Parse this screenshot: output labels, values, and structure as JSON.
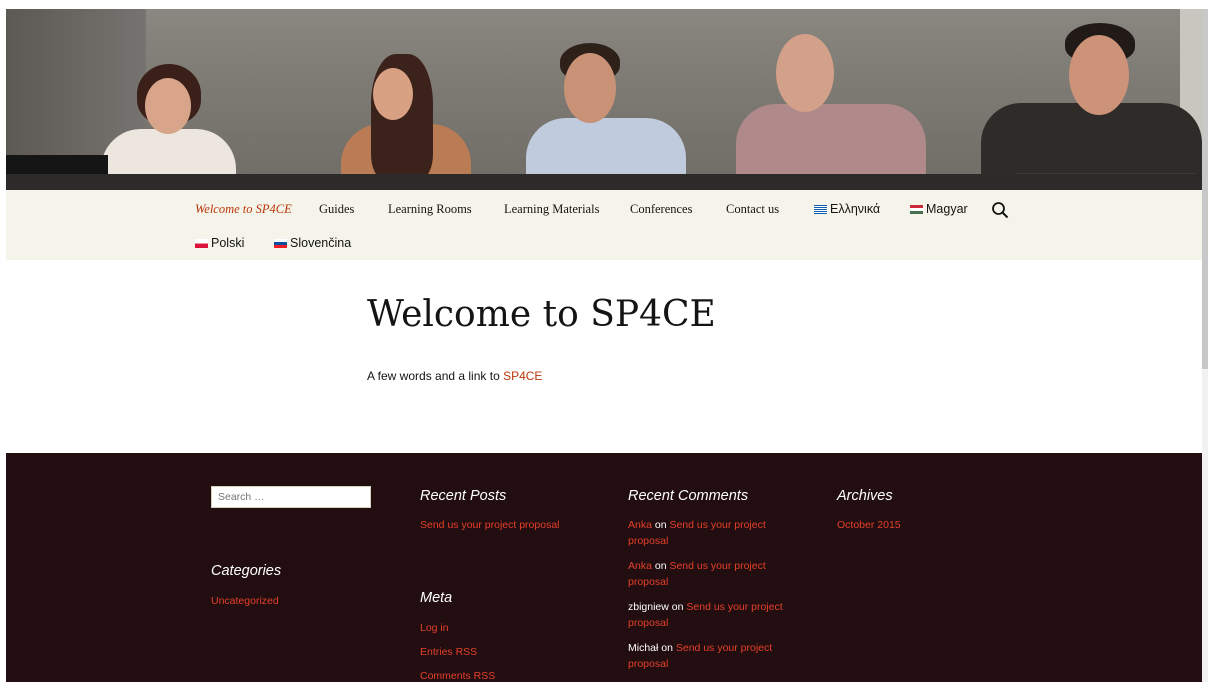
{
  "nav": {
    "items": [
      {
        "label": "Welcome to SP4CE",
        "active": true
      },
      {
        "label": "Guides"
      },
      {
        "label": "Learning Rooms"
      },
      {
        "label": "Learning Materials"
      },
      {
        "label": "Conferences"
      },
      {
        "label": "Contact us"
      },
      {
        "label": "Ελληνικά",
        "flag": "greece-flag-icon"
      },
      {
        "label": "Magyar",
        "flag": "hungary-flag-icon"
      },
      {
        "label": "Polski",
        "flag": "poland-flag-icon"
      },
      {
        "label": "Slovenčina",
        "flag": "slovakia-flag-icon"
      }
    ],
    "search_icon": "search-icon"
  },
  "main": {
    "title": "Welcome to SP4CE",
    "intro_text": "A few words and a link to ",
    "intro_link": "SP4CE"
  },
  "footer": {
    "search_placeholder": "Search …",
    "categories": {
      "title": "Categories",
      "items": [
        "Uncategorized"
      ]
    },
    "recent_posts": {
      "title": "Recent Posts",
      "items": [
        "Send us your project proposal"
      ]
    },
    "meta": {
      "title": "Meta",
      "items": [
        "Log in",
        "Entries RSS",
        "Comments RSS"
      ]
    },
    "recent_comments": {
      "title": "Recent Comments",
      "items": [
        {
          "author": "Anka",
          "author_linked": true,
          "on": "on",
          "post": "Send us your project proposal"
        },
        {
          "author": "Anka",
          "author_linked": true,
          "on": "on",
          "post": "Send us your project proposal"
        },
        {
          "author": "zbigniew",
          "author_linked": false,
          "on": "on",
          "post": "Send us your project proposal"
        },
        {
          "author": "Michał",
          "author_linked": false,
          "on": "on",
          "post": "Send us your project proposal"
        }
      ]
    },
    "archives": {
      "title": "Archives",
      "items": [
        "October 2015"
      ]
    }
  },
  "colors": {
    "accent": "#bc360a",
    "nav_bg": "#f5f4ea",
    "footer_bg": "#220e10",
    "footer_link": "#e63f2a"
  }
}
